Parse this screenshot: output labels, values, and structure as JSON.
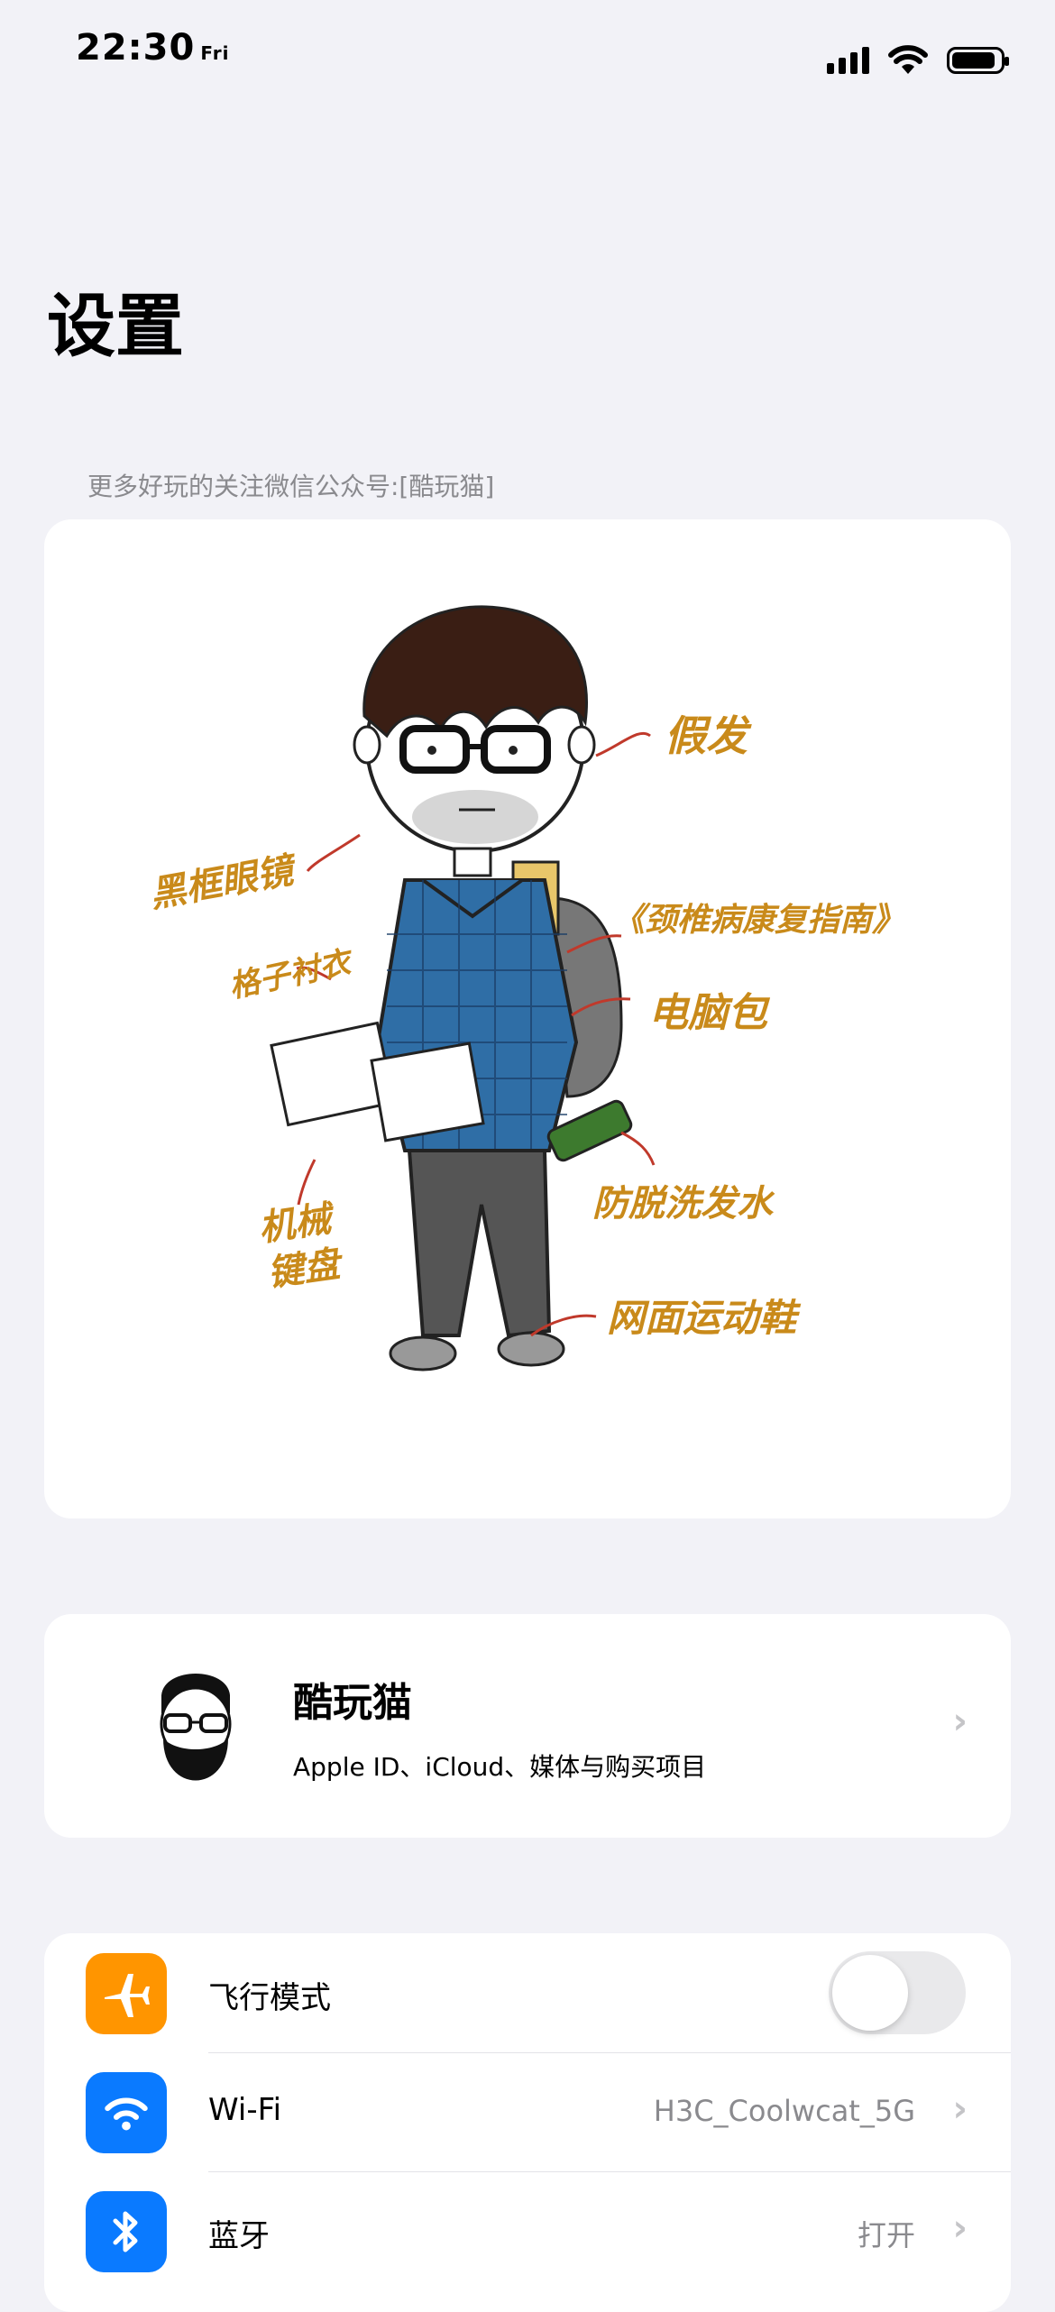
{
  "status_bar": {
    "time": "22:30",
    "day": "Fri"
  },
  "header": {
    "title": "设置"
  },
  "promo": {
    "caption": "更多好玩的关注微信公众号:[酷玩猫]",
    "illustration_labels": {
      "wig": "假发",
      "glasses": "黑框眼镜",
      "shirt": "格子衬衣",
      "book": "《颈椎病康复指南》",
      "backpack": "电脑包",
      "keyboard_line1": "机械",
      "keyboard_line2": "键盘",
      "shampoo": "防脱洗发水",
      "shoes": "网面运动鞋"
    }
  },
  "profile": {
    "name": "酷玩猫",
    "subtitle": "Apple ID、iCloud、媒体与购买项目",
    "icon": "bearded-man-avatar"
  },
  "settings": [
    {
      "label": "飞行模式",
      "icon": "airplane-icon",
      "color": "#ff9500",
      "toggle_on": false
    },
    {
      "label": "Wi-Fi",
      "icon": "wifi-icon",
      "color": "#0a7aff",
      "value": "H3C_Coolwcat_5G"
    },
    {
      "label": "蓝牙",
      "icon": "bluetooth-icon",
      "color": "#0a7aff",
      "value": "打开"
    }
  ],
  "colors": {
    "background": "#f2f2f7",
    "card": "#ffffff",
    "annotation": "#c98a1a",
    "arrow": "#c0392b"
  }
}
